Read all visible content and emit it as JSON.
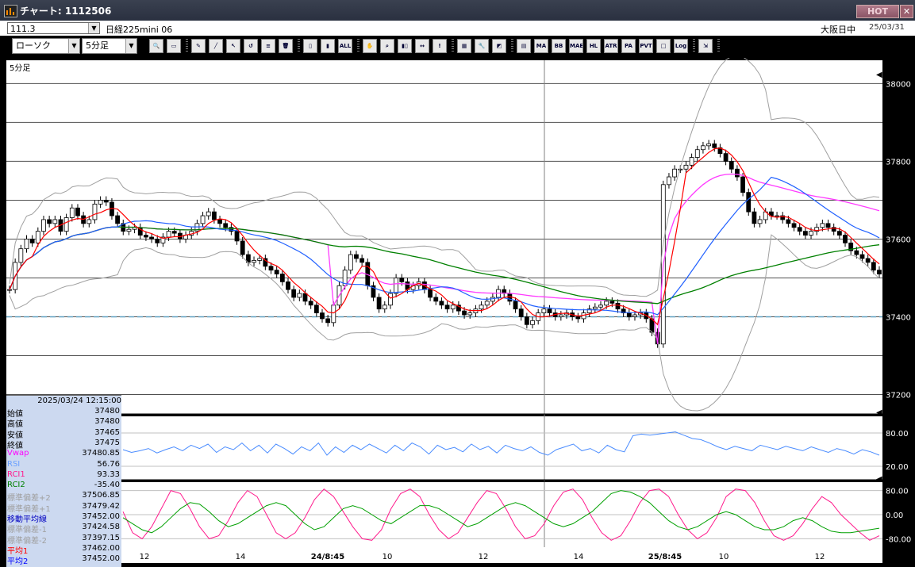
{
  "window": {
    "title": "チャート: 1112506",
    "hot_label": "HOT",
    "close_label": "✕"
  },
  "infobar": {
    "rate_value": "111.3",
    "symbol": "日経225mini 06",
    "session": "大阪日中",
    "date": "25/03/31"
  },
  "toolbar": {
    "chart_type": "ローソク",
    "timeframe": "5分足",
    "buttons": [
      {
        "name": "zoom",
        "label": "🔍"
      },
      {
        "name": "window",
        "label": "▭"
      },
      {
        "name": "pen",
        "label": "✎"
      },
      {
        "name": "line",
        "label": "╱"
      },
      {
        "name": "cursor",
        "label": "↖"
      },
      {
        "name": "undo",
        "label": "↺"
      },
      {
        "name": "note",
        "label": "≡"
      },
      {
        "name": "delete",
        "label": "🗑"
      },
      {
        "name": "candle-a",
        "label": "▯"
      },
      {
        "name": "candle-b",
        "label": "▮"
      },
      {
        "name": "all",
        "label": "ALL"
      },
      {
        "name": "hand",
        "label": "✋"
      },
      {
        "name": "search",
        "label": "⌕"
      },
      {
        "name": "bars",
        "label": "▮▯"
      },
      {
        "name": "arrows",
        "label": "↔"
      },
      {
        "name": "exclaim",
        "label": "!"
      },
      {
        "name": "pattern",
        "label": "▦"
      },
      {
        "name": "wrench",
        "label": "🔧"
      },
      {
        "name": "color",
        "label": "◩"
      },
      {
        "name": "multi",
        "label": "▤"
      },
      {
        "name": "ma",
        "label": "MA"
      },
      {
        "name": "bb",
        "label": "BB"
      },
      {
        "name": "mae",
        "label": "MAE"
      },
      {
        "name": "hl",
        "label": "HL"
      },
      {
        "name": "atr",
        "label": "ATR"
      },
      {
        "name": "para",
        "label": "PA"
      },
      {
        "name": "pvt",
        "label": "PVT"
      },
      {
        "name": "box",
        "label": "□"
      },
      {
        "name": "log",
        "label": "Log"
      },
      {
        "name": "export",
        "label": "⇲"
      }
    ]
  },
  "chart": {
    "timeframe_label": "5分足",
    "price_ticks": [
      "38000",
      "37800",
      "37600",
      "37400",
      "37200"
    ],
    "rsi_ticks": [
      "80.00",
      "20.00"
    ],
    "rci_ticks": [
      "80.00",
      "0.00",
      "-80.00"
    ],
    "x_labels": [
      {
        "text": "12",
        "bold": false
      },
      {
        "text": "14",
        "bold": false
      },
      {
        "text": "24/8:45",
        "bold": true
      },
      {
        "text": "10",
        "bold": false
      },
      {
        "text": "12",
        "bold": false
      },
      {
        "text": "14",
        "bold": false
      },
      {
        "text": "25/8:45",
        "bold": true
      },
      {
        "text": "10",
        "bold": false
      },
      {
        "text": "12",
        "bold": false
      }
    ],
    "colors": {
      "up_candle": "#ffffff",
      "down_candle": "#000000",
      "vwap": "#ff3aff",
      "bb": "#a0a0a0",
      "ma_short": "#ff0000",
      "ma_mid": "#2060ff",
      "ma_long": "#008000",
      "rsi": "#4a8cff",
      "rci1": "#ff1a8c",
      "rci2": "#00a000",
      "grid": "#505050",
      "dashed": "#5fa0c0"
    }
  },
  "chart_data": {
    "type": "candlestick",
    "timeframe": "5分足",
    "y_ticks": [
      38000,
      37800,
      37600,
      37400,
      37200
    ],
    "price_range": [
      37150,
      38060
    ],
    "closes": [
      37470,
      37540,
      37575,
      37600,
      37590,
      37620,
      37650,
      37640,
      37650,
      37620,
      37655,
      37680,
      37660,
      37640,
      37650,
      37690,
      37700,
      37695,
      37660,
      37640,
      37620,
      37625,
      37630,
      37610,
      37605,
      37600,
      37590,
      37605,
      37620,
      37615,
      37600,
      37610,
      37620,
      37640,
      37660,
      37670,
      37650,
      37640,
      37630,
      37620,
      37595,
      37560,
      37540,
      37545,
      37550,
      37530,
      37520,
      37510,
      37490,
      37470,
      37450,
      37460,
      37440,
      37430,
      37410,
      37395,
      37385,
      37430,
      37480,
      37520,
      37560,
      37550,
      37540,
      37480,
      37450,
      37420,
      37430,
      37460,
      37500,
      37490,
      37470,
      37480,
      37490,
      37470,
      37450,
      37440,
      37430,
      37420,
      37430,
      37415,
      37405,
      37410,
      37420,
      37430,
      37440,
      37450,
      37470,
      37460,
      37440,
      37420,
      37400,
      37380,
      37390,
      37410,
      37420,
      37410,
      37400,
      37405,
      37410,
      37400,
      37395,
      37410,
      37420,
      37425,
      37430,
      37440,
      37435,
      37420,
      37410,
      37400,
      37405,
      37410,
      37395,
      37360,
      37330,
      37740,
      37760,
      37780,
      37780,
      37790,
      37810,
      37830,
      37840,
      37845,
      37835,
      37820,
      37800,
      37780,
      37760,
      37720,
      37670,
      37640,
      37650,
      37670,
      37660,
      37660,
      37650,
      37640,
      37630,
      37620,
      37610,
      37620,
      37630,
      37640,
      37630,
      37620,
      37610,
      37590,
      37570,
      37560,
      37550,
      37540,
      37520,
      37510
    ],
    "ma_short_last": 37480,
    "vwap_last": 37480.85,
    "rsi_series": [
      50,
      45,
      48,
      52,
      44,
      50,
      55,
      48,
      58,
      52,
      60,
      45,
      55,
      50,
      62,
      48,
      58,
      44,
      60,
      52,
      42,
      55,
      48,
      62,
      40,
      55,
      45,
      58,
      50,
      60,
      52,
      44,
      58,
      48,
      62,
      55,
      42,
      58,
      50,
      54,
      46,
      60,
      50,
      56,
      44,
      58,
      52,
      48,
      55,
      45,
      40,
      50,
      55,
      60,
      48,
      52,
      44,
      58,
      50,
      46,
      75,
      78,
      76,
      78,
      80,
      82,
      76,
      70,
      68,
      62,
      55,
      50,
      56,
      52,
      48,
      58,
      54,
      50,
      56,
      52,
      48,
      55,
      50,
      45,
      52,
      48,
      42,
      50,
      46,
      40
    ],
    "rci1_series": [
      10,
      -60,
      -80,
      -40,
      20,
      80,
      70,
      20,
      -40,
      -80,
      -70,
      -20,
      40,
      80,
      60,
      0,
      -60,
      -80,
      -60,
      -10,
      50,
      85,
      60,
      10,
      -40,
      -80,
      -85,
      -50,
      20,
      70,
      85,
      60,
      0,
      -50,
      -80,
      -60,
      -10,
      40,
      80,
      70,
      20,
      -40,
      -80,
      -70,
      -30,
      30,
      75,
      85,
      50,
      -10,
      -60,
      -85,
      -70,
      -20,
      40,
      80,
      85,
      60,
      0,
      -50,
      -80,
      -60,
      -10,
      60,
      85,
      80,
      40,
      -20,
      -70,
      -85,
      -70,
      -30,
      20,
      60,
      40,
      0,
      -30,
      -60,
      -85,
      -70
    ],
    "rci2_series": [
      -10,
      -30,
      -50,
      -60,
      -40,
      -10,
      20,
      40,
      35,
      10,
      -20,
      -40,
      -30,
      -10,
      10,
      30,
      40,
      30,
      0,
      -30,
      -50,
      -40,
      -10,
      20,
      30,
      20,
      0,
      -20,
      -30,
      -10,
      10,
      30,
      30,
      20,
      0,
      -20,
      -40,
      -30,
      -10,
      10,
      30,
      40,
      30,
      10,
      -10,
      -30,
      -40,
      -30,
      -10,
      10,
      40,
      70,
      80,
      75,
      60,
      40,
      10,
      -20,
      -40,
      -50,
      -40,
      -20,
      0,
      10,
      0,
      -20,
      -40,
      -50,
      -50,
      -40,
      -20,
      -10,
      -20,
      -40,
      -55,
      -60,
      -60,
      -55,
      -50,
      -45
    ]
  },
  "datapanel": {
    "datetime": "2025/03/24  12:15:00",
    "rows": [
      {
        "label": "始値",
        "value": "37480",
        "color": "#000000"
      },
      {
        "label": "高値",
        "value": "37480",
        "color": "#000000"
      },
      {
        "label": "安値",
        "value": "37465",
        "color": "#000000"
      },
      {
        "label": "終値",
        "value": "37475",
        "color": "#000000"
      },
      {
        "label": "Vwap",
        "value": "37480.85",
        "color": "#ff00ff"
      },
      {
        "label": "RSI",
        "value": "56.76",
        "color": "#6aa0ff"
      },
      {
        "label": "RCI1",
        "value": "93.33",
        "color": "#ff1a8c"
      },
      {
        "label": "RCI2",
        "value": "-35.40",
        "color": "#008000"
      },
      {
        "label": "標準偏差+2",
        "value": "37506.85",
        "color": "#a0a0a0"
      },
      {
        "label": "標準偏差+1",
        "value": "37479.42",
        "color": "#a0a0a0"
      },
      {
        "label": "移動平均線",
        "value": "37452.00",
        "color": "#0000c0"
      },
      {
        "label": "標準偏差-1",
        "value": "37424.58",
        "color": "#a0a0a0"
      },
      {
        "label": "標準偏差-2",
        "value": "37397.15",
        "color": "#a0a0a0"
      },
      {
        "label": "平均1",
        "value": "37462.00",
        "color": "#ff0000"
      },
      {
        "label": "平均2",
        "value": "37452.00",
        "color": "#0000ff"
      }
    ]
  }
}
